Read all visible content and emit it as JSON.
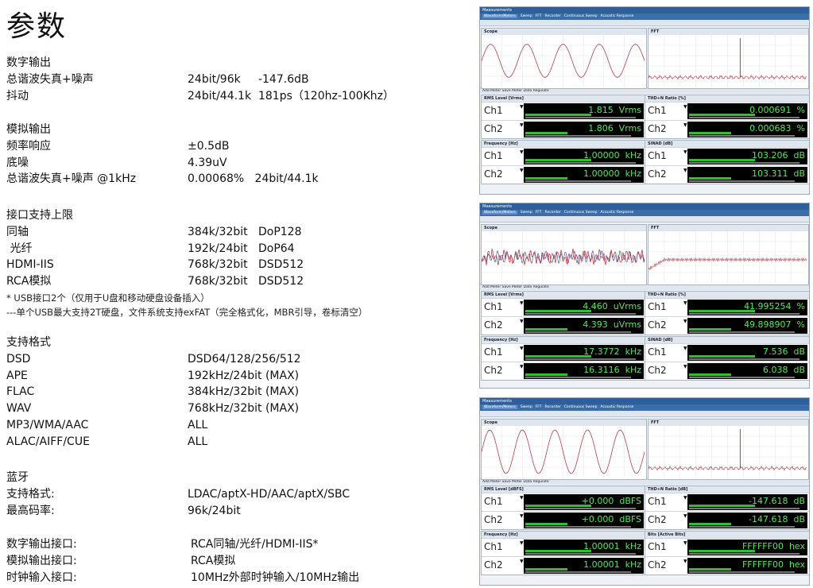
{
  "title": "参数",
  "sections": [
    {
      "label": "数字输出",
      "rows": [
        {
          "k": "总谐波失真+噪声",
          "v": "24bit/96k     -147.6dB"
        },
        {
          "k": "抖动",
          "v": "24bit/44.1k  181ps（120hz-100Khz）"
        }
      ]
    },
    {
      "label": "模拟输出",
      "rows": [
        {
          "k": "频率响应",
          "v": "±0.5dB"
        },
        {
          "k": "底噪",
          "v": "4.39uV"
        },
        {
          "k": "总谐波失真+噪声 @1kHz",
          "v": "0.00068%   24bit/44.1k"
        }
      ]
    },
    {
      "label": "接口支持上限",
      "rows": [
        {
          "k": "同轴",
          "v": "384k/32bit   DoP128"
        },
        {
          "k": " 光纤",
          "v": "192k/24bit   DoP64"
        },
        {
          "k": "HDMI-IIS",
          "v": "768k/32bit   DSD512"
        },
        {
          "k": "RCA模拟",
          "v": "768k/32bit   DSD512"
        }
      ]
    },
    {
      "label": "支持格式",
      "rows": [
        {
          "k": "DSD",
          "v": "DSD64/128/256/512"
        },
        {
          "k": "APE",
          "v": "192kHz/24bit (MAX)"
        },
        {
          "k": "FLAC",
          "v": "384kHz/32bit (MAX)"
        },
        {
          "k": "WAV",
          "v": "768kHz/32bit (MAX)"
        },
        {
          "k": "MP3/WMA/AAC",
          "v": "ALL"
        },
        {
          "k": "ALAC/AIFF/CUE",
          "v": "ALL"
        }
      ]
    },
    {
      "label": "蓝牙",
      "rows": [
        {
          "k": "支持格式:",
          "v": "LDAC/aptX-HD/AAC/aptX/SBC"
        },
        {
          "k": "最高码率:",
          "v": "96k/24bit"
        }
      ]
    },
    {
      "label": "",
      "rows": [
        {
          "k": "数字输出接口:",
          "v": "RCA同轴/光纤/HDMI-IIS*"
        },
        {
          "k": "模拟输出接口:",
          "v": "RCA模拟"
        },
        {
          "k": "时钟输入接口:",
          "v": "10MHz外部时钟输入/10MHz输出"
        }
      ]
    }
  ],
  "notes": [
    "* USB接口2个（仅用于U盘和移动硬盘设备插入）",
    "---单个USB最大支持2T硬盘，文件系统支持exFAT（完全格式化，MBR引导，卷标清空）"
  ],
  "app": {
    "window_title": "Measurements",
    "tabs": [
      "Waveform/Meters",
      "Sweep",
      "FFT",
      "Recorder",
      "Continuous Sweep",
      "Acoustic Response"
    ],
    "scope_label": "Scope",
    "fft_label": "FFT",
    "add_meter": "Add Meter",
    "save_meter": "Save Meter Data",
    "regulate": "Regulate"
  },
  "panels": [
    {
      "meters": [
        {
          "name": "RMS Level",
          "unit_sel": "Vrms",
          "ch1": "1.815",
          "ch2": "1.806",
          "unit": "Vrms"
        },
        {
          "name": "THD+N Ratio",
          "unit_sel": "%",
          "ch1": "0.000691",
          "ch2": "0.000683",
          "unit": "%"
        },
        {
          "name": "Frequency",
          "unit_sel": "Hz",
          "ch1": "1.00000",
          "ch2": "1.00000",
          "unit": "kHz"
        },
        {
          "name": "SINAD",
          "unit_sel": "dB",
          "ch1": "103.206",
          "ch2": "103.311",
          "unit": "dB"
        }
      ]
    },
    {
      "meters": [
        {
          "name": "RMS Level",
          "unit_sel": "Vrms",
          "ch1": "4.460",
          "ch2": "4.393",
          "unit": "uVrms"
        },
        {
          "name": "THD+N Ratio",
          "unit_sel": "%",
          "ch1": "41.995254",
          "ch2": "49.898907",
          "unit": "%"
        },
        {
          "name": "Frequency",
          "unit_sel": "Hz",
          "ch1": "17.3772",
          "ch2": "16.3116",
          "unit": "kHz"
        },
        {
          "name": "SINAD",
          "unit_sel": "dB",
          "ch1": "7.536",
          "ch2": "6.038",
          "unit": "dB"
        }
      ]
    },
    {
      "meters": [
        {
          "name": "RMS Level",
          "unit_sel": "dBFS",
          "ch1": "+0.000",
          "ch2": "+0.000",
          "unit": "dBFS"
        },
        {
          "name": "THD+N Ratio",
          "unit_sel": "dB",
          "ch1": "-147.618",
          "ch2": "-147.618",
          "unit": "dB"
        },
        {
          "name": "Frequency",
          "unit_sel": "Hz",
          "ch1": "1.00001",
          "ch2": "1.00001",
          "unit": "kHz"
        },
        {
          "name": "Bits",
          "unit_sel": "Active Bits",
          "ch1": "FFFFFF00",
          "ch2": "FFFFFF00",
          "unit": "hex"
        }
      ]
    }
  ]
}
